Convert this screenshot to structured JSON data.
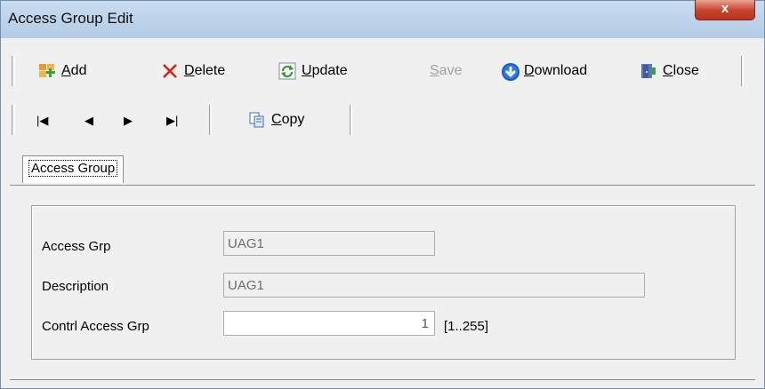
{
  "window": {
    "title": "Access Group Edit",
    "close_symbol": "x"
  },
  "toolbar1": {
    "add_label": "Add",
    "delete_label": "Delete",
    "update_label": "Update",
    "save_label": "Save",
    "download_label": "Download",
    "close_label": "Close"
  },
  "toolbar2": {
    "first_symbol": "|◀",
    "prev_symbol": "◀",
    "next_symbol": "▶",
    "last_symbol": "▶|",
    "copy_label": "Copy"
  },
  "tabs": [
    {
      "label": "Access Group"
    }
  ],
  "form": {
    "access_grp_label": "Access Grp",
    "access_grp_value": "UAG1",
    "description_label": "Description",
    "description_value": "UAG1",
    "contrl_label": "Contrl Access Grp",
    "contrl_value": "1",
    "contrl_range": "[1..255]"
  },
  "colors": {
    "titlebar": "#bcd2ea",
    "close_button": "#c8412b",
    "download_icon": "#1a5bbf"
  }
}
